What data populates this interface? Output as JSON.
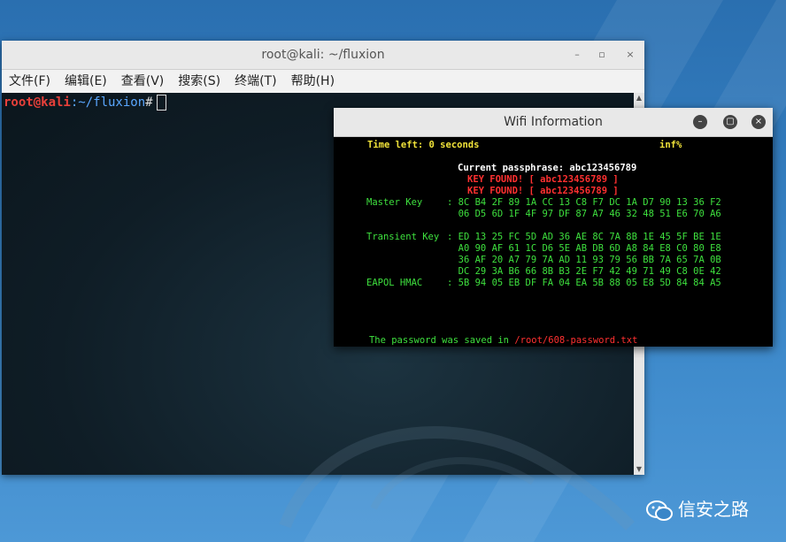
{
  "terminal": {
    "title": "root@kali: ~/fluxion",
    "menu": [
      "文件(F)",
      "编辑(E)",
      "查看(V)",
      "搜索(S)",
      "终端(T)",
      "帮助(H)"
    ],
    "prompt_user": "root@kali",
    "prompt_path": ":~/fluxion",
    "prompt_symbol": "#"
  },
  "wifi": {
    "title": "Wifi Information",
    "time_left": "Time left: 0 seconds",
    "infinity": "inf%",
    "current_passphrase": "Current passphrase: abc123456789",
    "key_found_1": "KEY FOUND! [ abc123456789 ]",
    "key_found_2": "KEY FOUND! [ abc123456789 ]",
    "master_key_label": "Master Key",
    "master_key_1": ": 8C B4 2F 89 1A CC 13 C8 F7 DC 1A D7 90 13 36 F2",
    "master_key_2": "  06 D5 6D 1F 4F 97 DF 87 A7 46 32 48 51 E6 70 A6",
    "transient_key_label": "Transient Key",
    "transient_key_1": ": ED 13 25 FC 5D AD 36 AE 8C 7A 8B 1E 45 5F BE 1E",
    "transient_key_2": "  A0 90 AF 61 1C D6 5E AB DB 6D A8 84 E8 C0 80 E8",
    "transient_key_3": "  36 AF 20 A7 79 7A AD 11 93 79 56 BB 7A 65 7A 0B",
    "transient_key_4": "  DC 29 3A B6 66 8B B3 2E F7 42 49 71 49 C8 0E 42",
    "eapol_label": "EAPOL HMAC",
    "eapol_1": ": 5B 94 05 EB DF FA 04 EA 5B 88 05 E8 5D 84 84 A5",
    "saved_prefix": "The password was saved in ",
    "saved_path": "/root/608-password.txt"
  },
  "watermark": {
    "text": "信安之路"
  }
}
